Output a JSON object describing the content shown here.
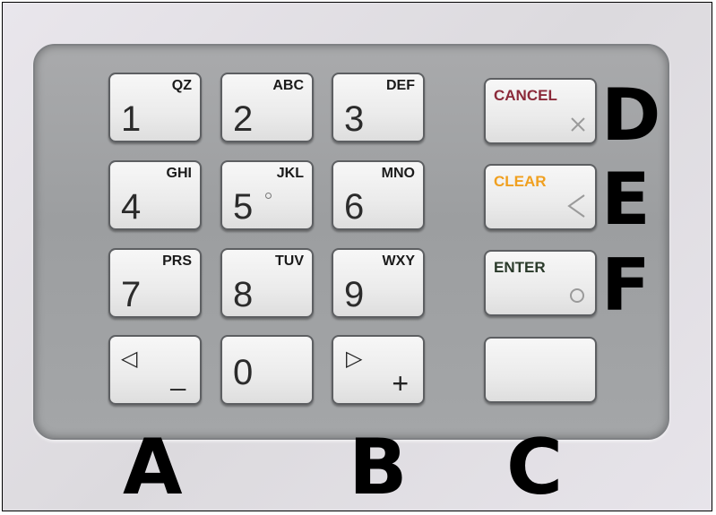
{
  "keypad": {
    "number_keys": [
      {
        "digit": "1",
        "letters": "QZ"
      },
      {
        "digit": "2",
        "letters": "ABC"
      },
      {
        "digit": "3",
        "letters": "DEF"
      },
      {
        "digit": "4",
        "letters": "GHI"
      },
      {
        "digit": "5",
        "letters": "JKL"
      },
      {
        "digit": "6",
        "letters": "MNO"
      },
      {
        "digit": "7",
        "letters": "PRS"
      },
      {
        "digit": "8",
        "letters": "TUV"
      },
      {
        "digit": "9",
        "letters": "WXY"
      },
      {
        "digit": "0",
        "letters": ""
      }
    ],
    "left_key": {
      "symbol": "◁",
      "sub": "_"
    },
    "right_key": {
      "symbol": "▷",
      "sub": "+"
    },
    "function_keys": [
      {
        "label": "CANCEL",
        "color": "#8b2a3a",
        "icon": "x-icon"
      },
      {
        "label": "CLEAR",
        "color": "#f0a020",
        "icon": "back-chevron-icon"
      },
      {
        "label": "ENTER",
        "color": "#2a3a2a",
        "icon": "circle-icon"
      },
      {
        "label": "",
        "color": "",
        "icon": ""
      }
    ]
  },
  "annotations": [
    "A",
    "B",
    "C",
    "D",
    "E",
    "F"
  ]
}
